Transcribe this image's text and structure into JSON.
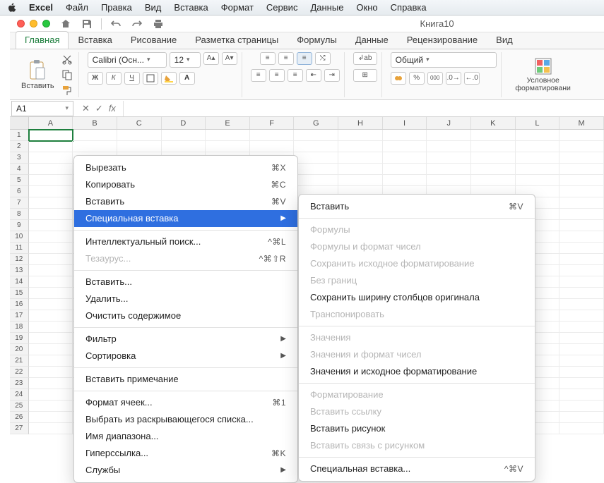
{
  "mac_menu": {
    "app": "Excel",
    "items": [
      "Файл",
      "Правка",
      "Вид",
      "Вставка",
      "Формат",
      "Сервис",
      "Данные",
      "Окно",
      "Справка"
    ]
  },
  "doc_title": "Книга10",
  "ribbon_tabs": [
    "Главная",
    "Вставка",
    "Рисование",
    "Разметка страницы",
    "Формулы",
    "Данные",
    "Рецензирование",
    "Вид"
  ],
  "ribbon": {
    "paste": "Вставить",
    "font_name": "Calibri (Осн...",
    "font_size": "12",
    "number_format": "Общий",
    "bold": "Ж",
    "italic": "К",
    "underline": "Ч",
    "percent": "%",
    "thousands": "000",
    "cond_format": "Условное форматировани"
  },
  "namebox": "A1",
  "columns": [
    "A",
    "B",
    "C",
    "D",
    "E",
    "F",
    "G",
    "H",
    "I",
    "J",
    "K",
    "L",
    "M"
  ],
  "context_menu": {
    "cut": "Вырезать",
    "cut_sc": "⌘X",
    "copy": "Копировать",
    "copy_sc": "⌘C",
    "paste": "Вставить",
    "paste_sc": "⌘V",
    "paste_special": "Специальная вставка",
    "smart_lookup": "Интеллектуальный поиск...",
    "smart_sc": "^⌘L",
    "thesaurus": "Тезаурус...",
    "thes_sc": "^⌘⇧R",
    "insert": "Вставить...",
    "delete": "Удалить...",
    "clear": "Очистить содержимое",
    "filter": "Фильтр",
    "sort": "Сортировка",
    "comment": "Вставить примечание",
    "format_cells": "Формат ячеек...",
    "format_sc": "⌘1",
    "dropdown": "Выбрать из раскрывающегося списка...",
    "range_name": "Имя диапазона...",
    "hyperlink": "Гиперссылка...",
    "hyper_sc": "⌘K",
    "services": "Службы"
  },
  "submenu": {
    "paste": "Вставить",
    "paste_sc": "⌘V",
    "formulas": "Формулы",
    "formulas_num": "Формулы и формат чисел",
    "keep_src": "Сохранить исходное форматирование",
    "no_borders": "Без границ",
    "keep_width": "Сохранить ширину столбцов оригинала",
    "transpose": "Транспонировать",
    "values": "Значения",
    "values_num": "Значения и формат чисел",
    "values_src": "Значения и исходное форматирование",
    "formatting": "Форматирование",
    "paste_link": "Вставить ссылку",
    "paste_pic": "Вставить рисунок",
    "paste_linked_pic": "Вставить связь с рисунком",
    "special": "Специальная вставка...",
    "special_sc": "^⌘V"
  }
}
